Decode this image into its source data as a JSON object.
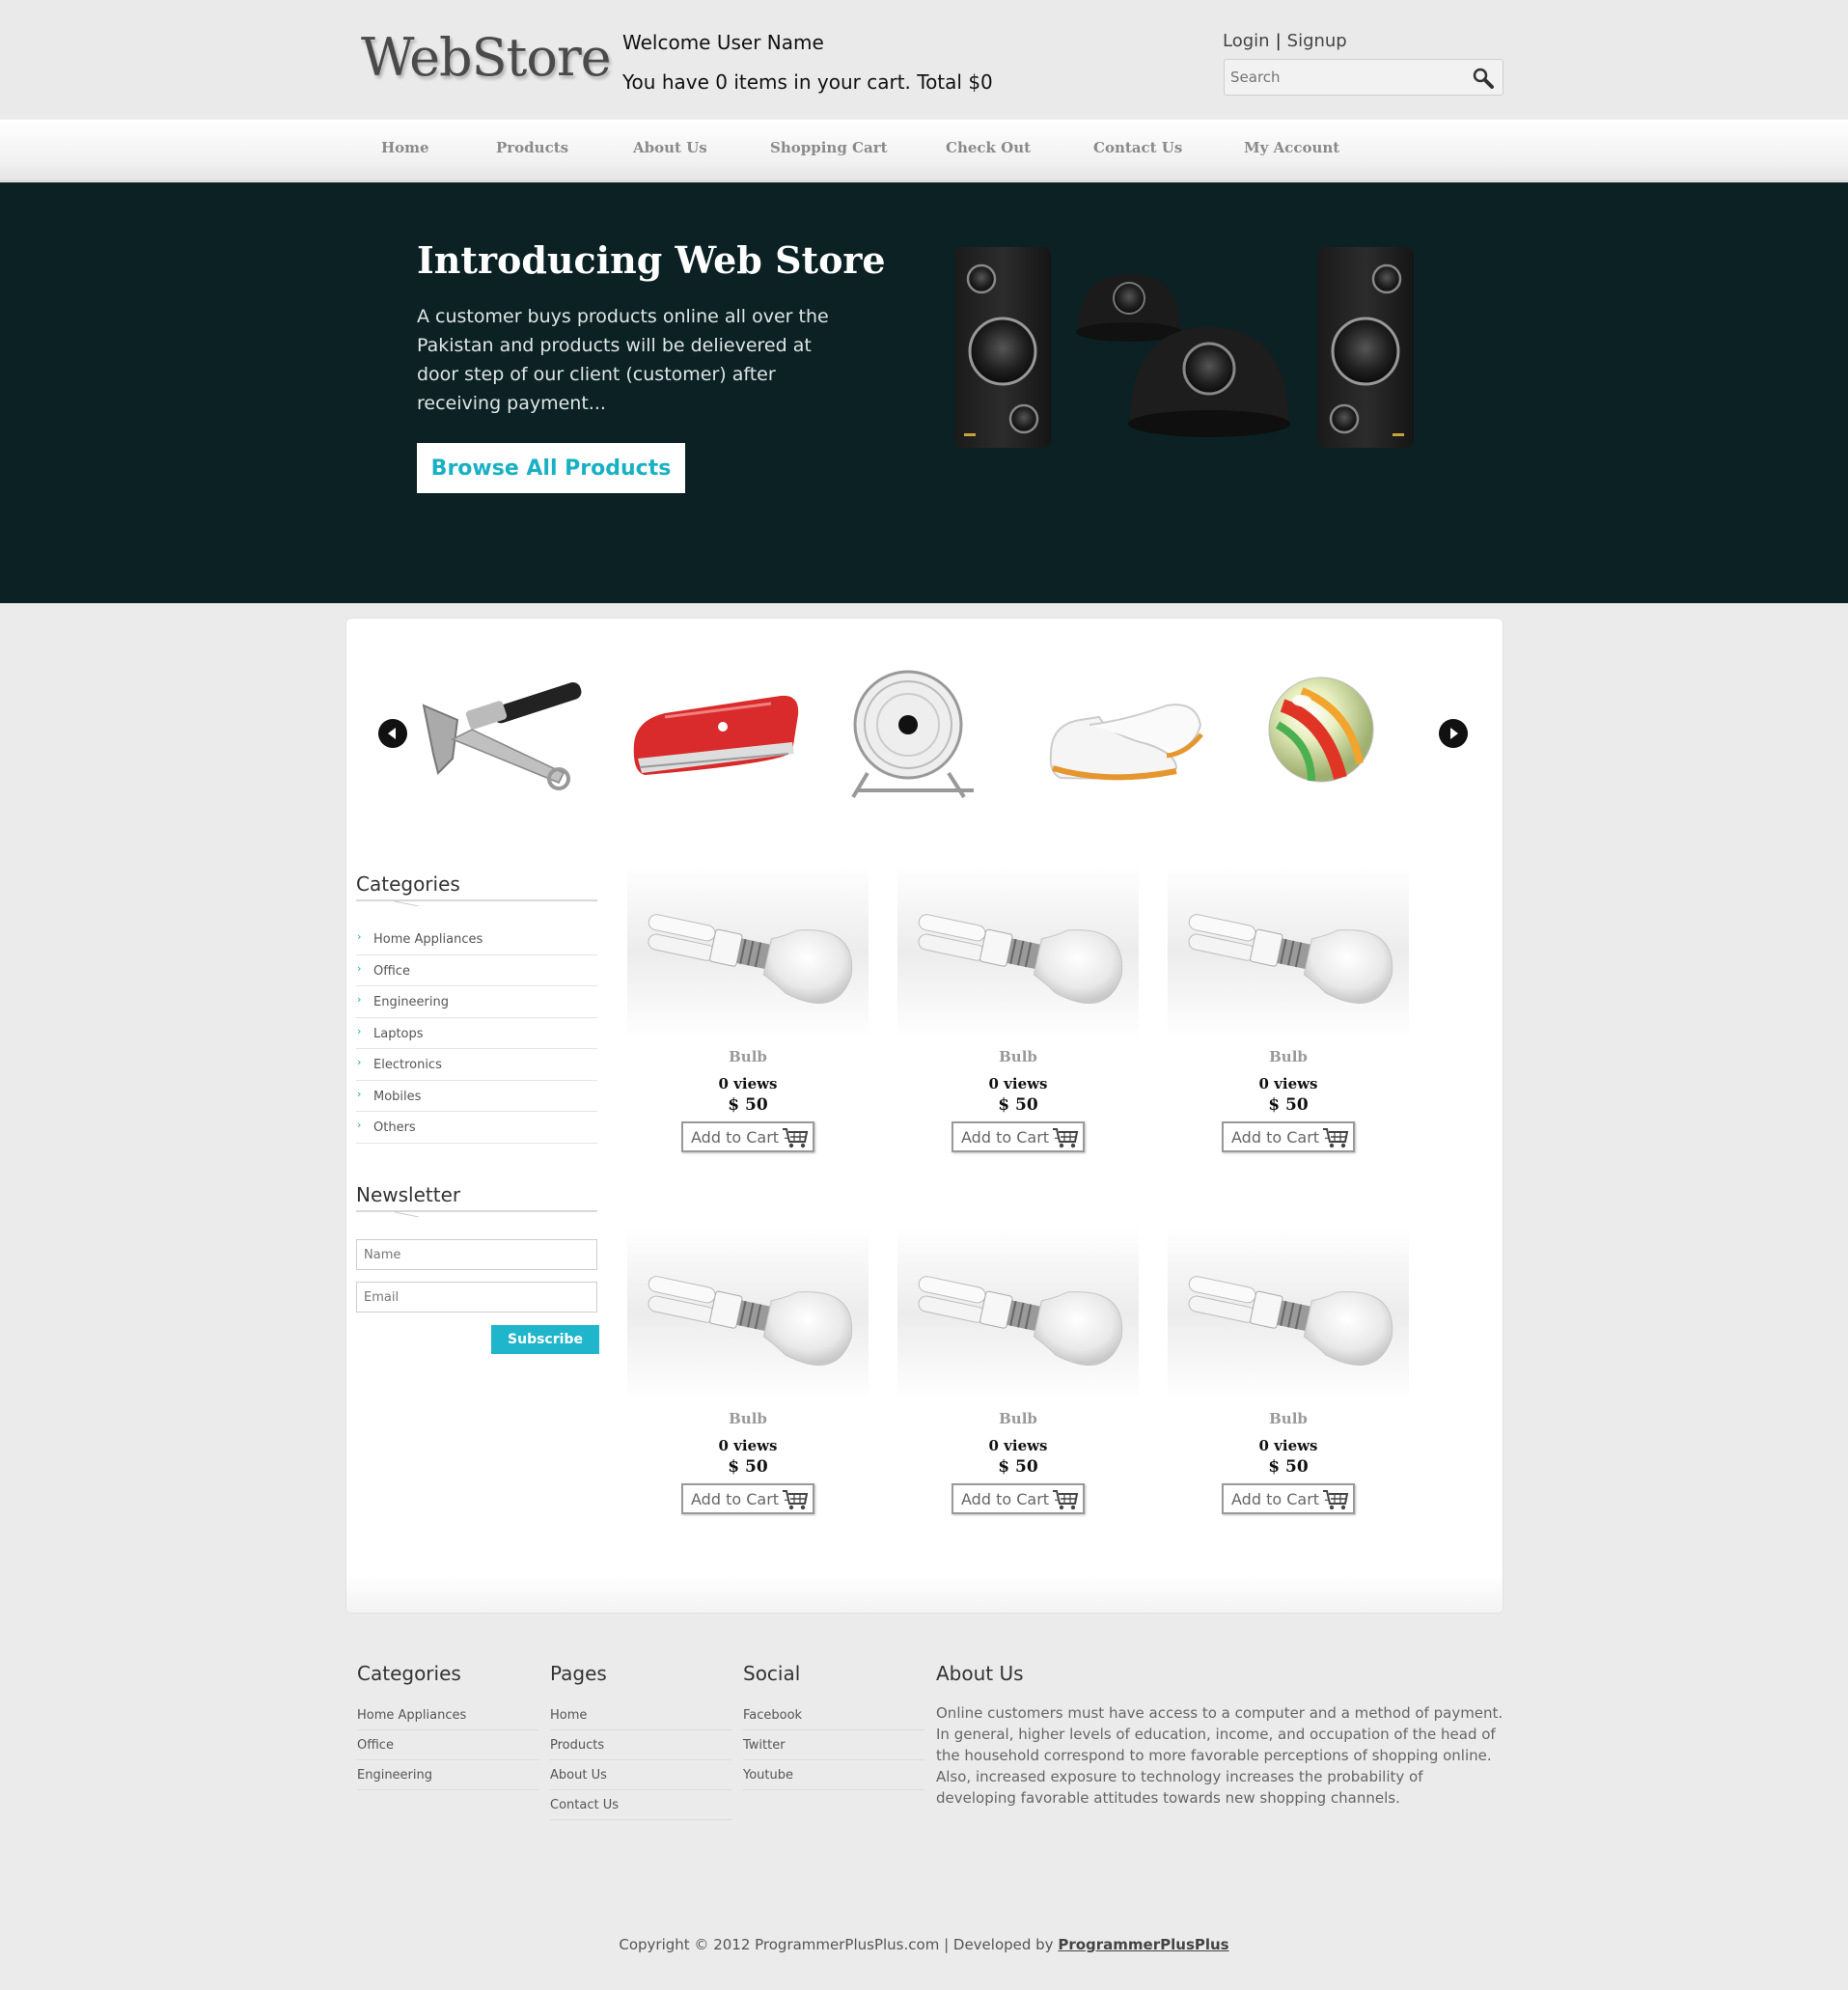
{
  "header": {
    "logo": "WebStore",
    "welcome": "Welcome User Name",
    "cart_summary": "You have 0 items in your cart. Total $0",
    "login": "Login",
    "signup": "Signup",
    "search_placeholder": "Search"
  },
  "nav": [
    "Home",
    "Products",
    "About Us",
    "Shopping Cart",
    "Check Out",
    "Contact Us",
    "My Account"
  ],
  "hero": {
    "title": "Introducing Web Store",
    "text": "A customer buys products online all over the Pakistan and products will be delievered at door step of our client (customer) after receiving payment...",
    "button": "Browse All Products"
  },
  "carousel": {
    "items": [
      "hammer",
      "pocket-knife",
      "fan",
      "shoes",
      "marble"
    ]
  },
  "sidebar": {
    "categories_title": "Categories",
    "categories": [
      "Home Appliances",
      "Office",
      "Engineering",
      "Laptops",
      "Electronics",
      "Mobiles",
      "Others"
    ],
    "newsletter_title": "Newsletter",
    "name_placeholder": "Name",
    "email_placeholder": "Email",
    "subscribe": "Subscribe"
  },
  "products": [
    {
      "name": "Bulb",
      "views": "0 views",
      "price": "$ 50",
      "add": "Add to Cart -"
    },
    {
      "name": "Bulb",
      "views": "0 views",
      "price": "$ 50",
      "add": "Add to Cart -"
    },
    {
      "name": "Bulb",
      "views": "0 views",
      "price": "$ 50",
      "add": "Add to Cart -"
    },
    {
      "name": "Bulb",
      "views": "0 views",
      "price": "$ 50",
      "add": "Add to Cart -"
    },
    {
      "name": "Bulb",
      "views": "0 views",
      "price": "$ 50",
      "add": "Add to Cart -"
    },
    {
      "name": "Bulb",
      "views": "0 views",
      "price": "$ 50",
      "add": "Add to Cart -"
    }
  ],
  "footer": {
    "categories_title": "Categories",
    "categories": [
      "Home Appliances",
      "Office",
      "Engineering"
    ],
    "pages_title": "Pages",
    "pages": [
      "Home",
      "Products",
      "About Us",
      "Contact Us"
    ],
    "social_title": "Social",
    "social": [
      "Facebook",
      "Twitter",
      "Youtube"
    ],
    "about_title": "About Us",
    "about_text": "Online customers must have access to a computer and a method of payment. In general, higher levels of education, income, and occupation of the head of the household correspond to more favorable perceptions of shopping online. Also, increased exposure to technology increases the probability of developing favorable attitudes towards new shopping channels.",
    "copyright": "Copyright © 2012 ProgrammerPlusPlus.com | Developed by",
    "developer": "ProgrammerPlusPlus"
  },
  "colors": {
    "accent": "#1fb5cb",
    "hero_bg": "#0b2124",
    "page_bg": "#ebebeb"
  }
}
